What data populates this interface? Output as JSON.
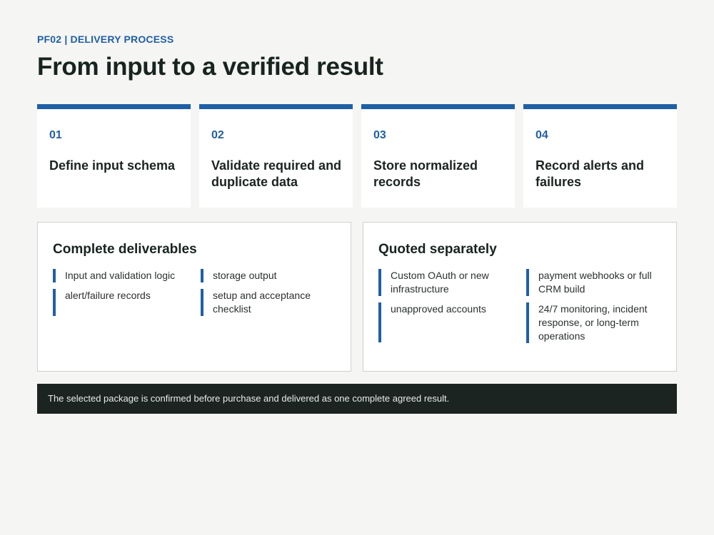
{
  "header": {
    "eyebrow": "PF02 | DELIVERY PROCESS",
    "title": "From input to a verified result"
  },
  "steps": [
    {
      "number": "01",
      "label": "Define input schema"
    },
    {
      "number": "02",
      "label": "Validate required and duplicate data"
    },
    {
      "number": "03",
      "label": "Store normalized records"
    },
    {
      "number": "04",
      "label": "Record alerts and failures"
    }
  ],
  "deliverables": {
    "title": "Complete deliverables",
    "col1": [
      "Input and validation logic",
      "alert/failure records"
    ],
    "col2": [
      "storage output",
      "setup and acceptance checklist"
    ]
  },
  "quoted": {
    "title": "Quoted separately",
    "col1": [
      "Custom OAuth or new infrastructure",
      "unapproved accounts"
    ],
    "col2": [
      "payment webhooks or full CRM build",
      "24/7 monitoring, incident response, or long-term operations"
    ]
  },
  "footer": {
    "note": "The selected package is confirmed before purchase and delivered as one complete agreed result."
  },
  "colors": {
    "accent": "#1f5fa6",
    "dark": "#1b2420",
    "background": "#f5f5f3"
  }
}
